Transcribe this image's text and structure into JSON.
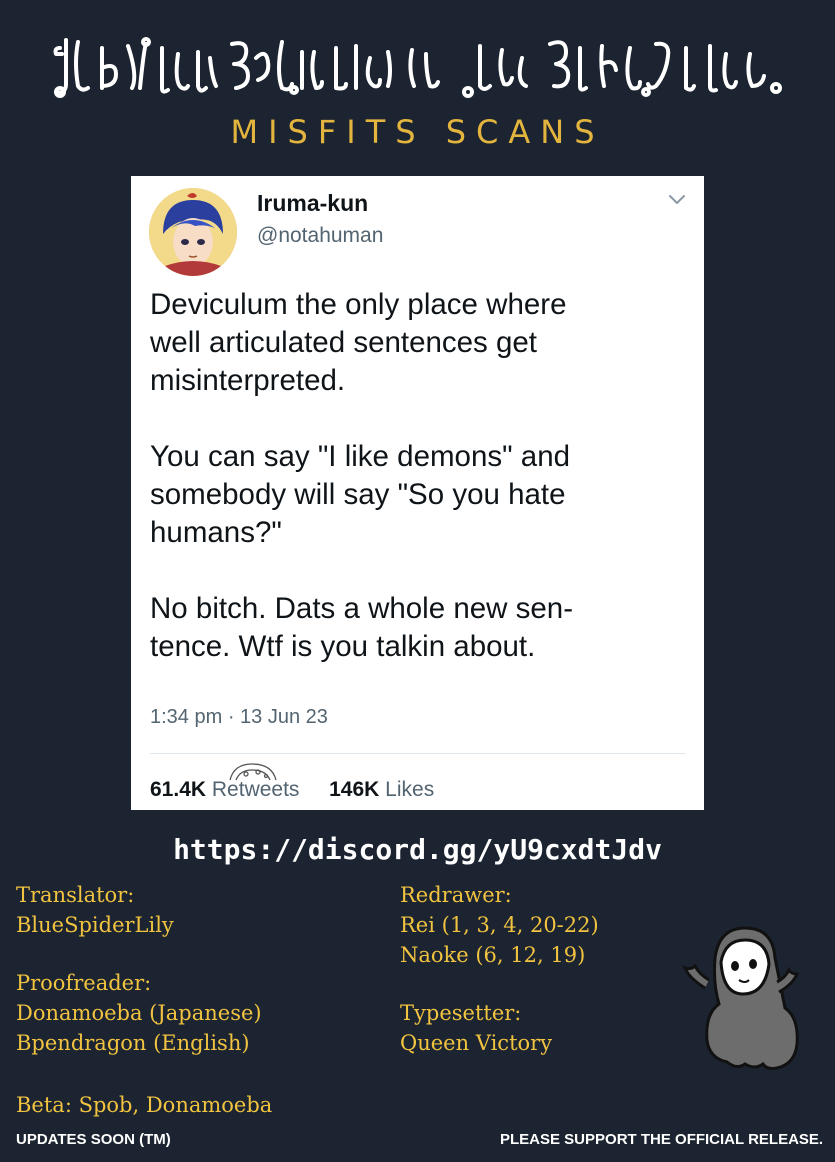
{
  "header": {
    "brand_name": "MISFITS SCANS",
    "brand_logo_icon": "demon-script-glyphs",
    "accent_color": "#e3b43e"
  },
  "tweet": {
    "display_name": "Iruma-kun",
    "handle": "@notahuman",
    "avatar_icon": "anime-avatar",
    "menu_icon": "chevron-down-icon",
    "paragraphs": [
      "Deviculum the only place where\nwell articulated sentences get\nmisinterpreted.",
      "You can say \"I like demons\" and\nsomebody will say \"So you hate\nhumans?\"",
      "No bitch. Dats a whole new sen-\ntence. Wtf is you talkin about."
    ],
    "time": "1:34 pm",
    "separator": " · ",
    "date": "13 Jun 23",
    "retweets_count": "61.4K",
    "retweets_label": "Retweets",
    "likes_count": "146K",
    "likes_label": "Likes"
  },
  "discord_link": "https://discord.gg/yU9cxdtJdv",
  "credits": {
    "translator_label": "Translator:",
    "translator": "BlueSpiderLily",
    "proofreader_label": "Proofreader:",
    "proofreaders": [
      "Donamoeba (Japanese)",
      "Bpendragon (English)"
    ],
    "beta": "Beta: Spob, Donamoeba",
    "redrawer_label": "Redrawer:",
    "redrawers": [
      "Rei (1, 3, 4, 20-22)",
      "Naoke (6, 12, 19)"
    ],
    "typesetter_label": "Typesetter:",
    "typesetter": "Queen Victory"
  },
  "footer": {
    "left": "UPDATES SOON (TM)",
    "right": "PLEASE SUPPORT THE OFFICIAL RELEASE."
  },
  "mascot_icon": "hooded-ghost-mascot"
}
